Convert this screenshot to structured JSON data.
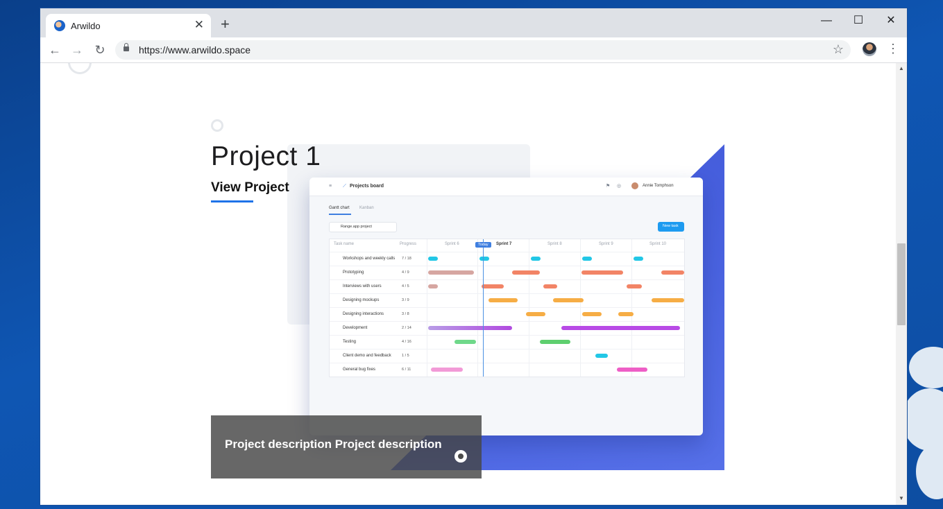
{
  "browser": {
    "tab_title": "Arwildo",
    "new_tab": "+",
    "tab_close": "✕",
    "url": "https://www.arwildo.space",
    "minimize": "—",
    "maximize": "☐",
    "close": "✕",
    "back": "←",
    "forward": "→",
    "reload": "↻",
    "star": "☆",
    "menu": "⋮"
  },
  "page": {
    "title": "Project 1",
    "view_link": "View Project",
    "description": "Project description Project description"
  },
  "mockup": {
    "app_title": "Projects board",
    "user_name": "Annie Tomphson",
    "tabs": [
      "Gantt chart",
      "Kanban"
    ],
    "project_select": "Range.app project",
    "new_task": "New task",
    "headers": {
      "task": "Task name",
      "progress": "Progress"
    },
    "sprints": [
      "Sprint 6",
      "Sprint 7",
      "Sprint 8",
      "Sprint 9",
      "Sprint 10"
    ],
    "today": "Today",
    "rows": [
      {
        "name": "Workshops and weekly calls",
        "progress": "7 / 18"
      },
      {
        "name": "Prototyping",
        "progress": "4 / 9"
      },
      {
        "name": "Interviews with users",
        "progress": "4 / 5"
      },
      {
        "name": "Designing mockups",
        "progress": "3 / 9"
      },
      {
        "name": "Designing interactions",
        "progress": "3 / 8"
      },
      {
        "name": "Development",
        "progress": "2 / 14"
      },
      {
        "name": "Testing",
        "progress": "4 / 16"
      },
      {
        "name": "Client demo and feedback",
        "progress": "1 / 5"
      },
      {
        "name": "General bug fixes",
        "progress": "6 / 11"
      }
    ]
  }
}
